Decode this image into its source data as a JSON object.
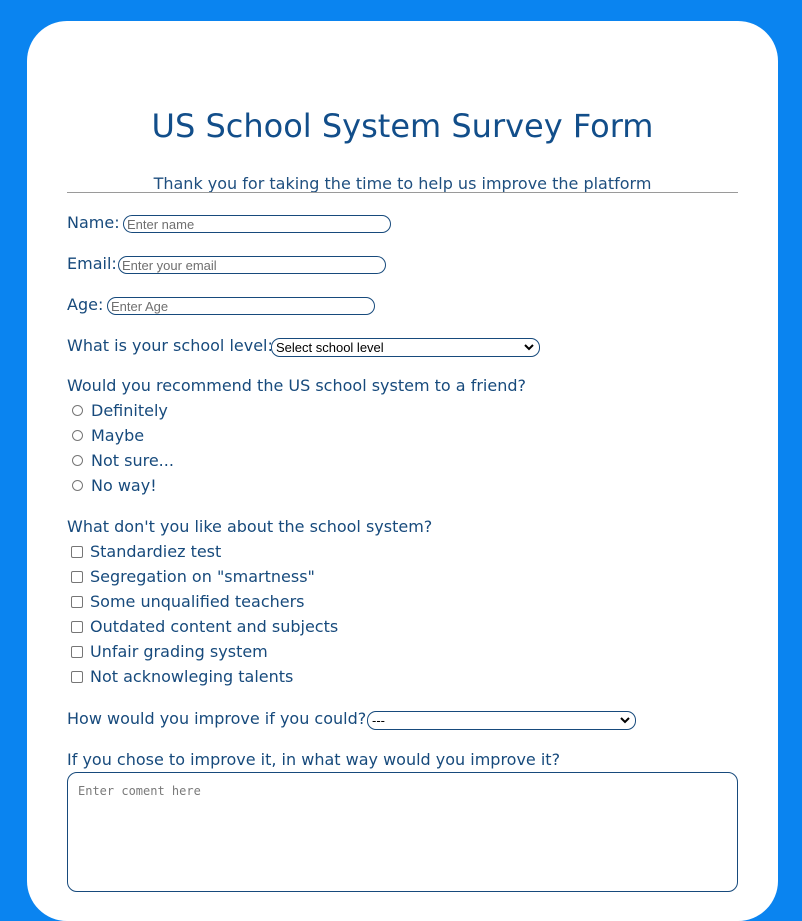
{
  "form": {
    "title": "US School System Survey Form",
    "description": "Thank you for taking the time to help us improve the platform",
    "name": {
      "label": "Name:",
      "placeholder": "Enter name"
    },
    "email": {
      "label": "Email:",
      "placeholder": "Enter your email"
    },
    "age": {
      "label": "Age:",
      "placeholder": "Enter Age"
    },
    "school_level": {
      "label": "What is your school level:",
      "selected": "Select school level"
    },
    "recommend": {
      "question": "Would you recommend the US school system to a friend?",
      "options": [
        "Definitely",
        "Maybe",
        "Not sure...",
        "No way!"
      ]
    },
    "dislikes": {
      "question": "What don't you like about the school system?",
      "options": [
        "Standardiez test",
        "Segregation on \"smartness\"",
        "Some unqualified teachers",
        "Outdated content and subjects",
        "Unfair grading system",
        "Not acknowleging talents"
      ]
    },
    "improve": {
      "label": "How would you improve if you could?",
      "selected": "---"
    },
    "comment": {
      "label": "If you chose to improve it, in what way would you improve it?",
      "placeholder": "Enter coment here"
    }
  },
  "colors": {
    "page_background": "#0a84f0",
    "card_background": "#ffffff",
    "heading": "#124e8a",
    "text": "#174a7c"
  }
}
